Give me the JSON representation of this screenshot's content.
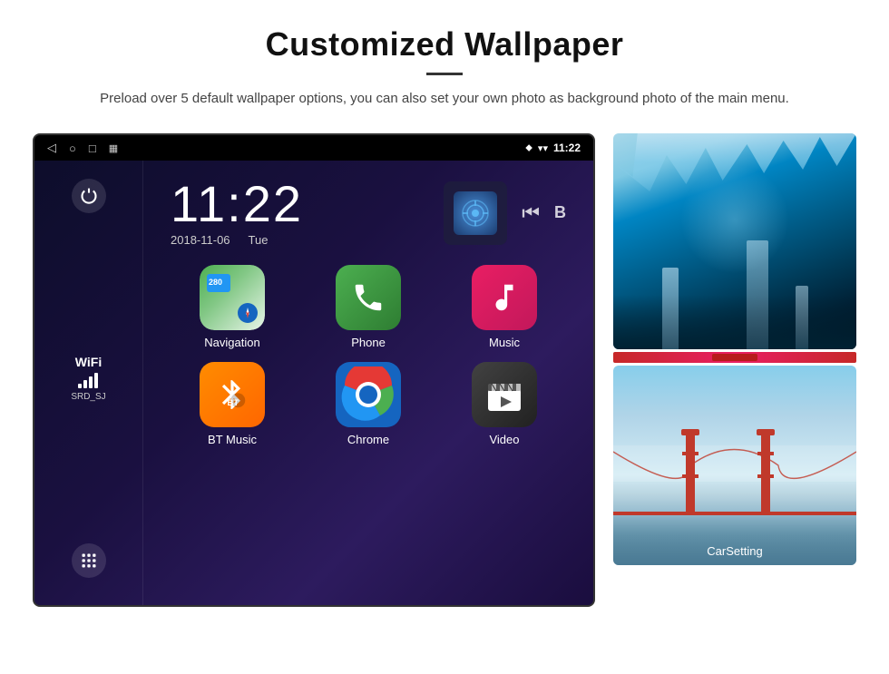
{
  "header": {
    "title": "Customized Wallpaper",
    "description": "Preload over 5 default wallpaper options, you can also set your own photo as background photo of the main menu."
  },
  "device": {
    "status_bar": {
      "time": "11:22",
      "nav_back": "◁",
      "nav_home": "○",
      "nav_recent": "□",
      "nav_screenshot": "▦",
      "location_icon": "📍",
      "wifi_icon": "▼",
      "time_display": "11:22"
    },
    "clock": {
      "time": "11:22",
      "date": "2018-11-06",
      "day": "Tue"
    },
    "sidebar": {
      "wifi_label": "WiFi",
      "wifi_ssid": "SRD_SJ"
    },
    "apps": [
      {
        "label": "Navigation",
        "icon_type": "nav"
      },
      {
        "label": "Phone",
        "icon_type": "phone"
      },
      {
        "label": "Music",
        "icon_type": "music"
      },
      {
        "label": "BT Music",
        "icon_type": "btmusic"
      },
      {
        "label": "Chrome",
        "icon_type": "chrome"
      },
      {
        "label": "Video",
        "icon_type": "video"
      }
    ]
  },
  "wallpapers": [
    {
      "label": "Ice Cave",
      "type": "ice"
    },
    {
      "label": "Golden Gate Bridge",
      "type": "bridge"
    },
    {
      "label": "CarSetting",
      "type": "carsetting"
    }
  ]
}
